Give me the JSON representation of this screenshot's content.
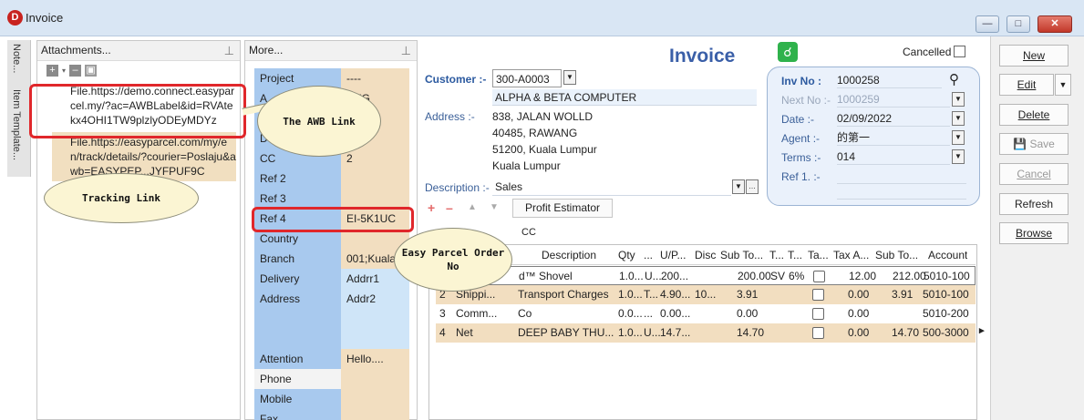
{
  "window": {
    "title": "Invoice",
    "app_icon": "D"
  },
  "side_tabs": [
    "Note...",
    "Item Template..."
  ],
  "attachments": {
    "title": "Attachments...",
    "files": [
      "File.https://demo.connect.easyparcel.my/?ac=AWBLabel&id=RVAtekx4OHI1TW9plzlyODEyMDYz",
      "File.https://easyparcel.com/my/en/track/details/?courier=Poslaju&awb=EASYPEP...JYFPUF9C"
    ]
  },
  "more": {
    "title": "More...",
    "rows": [
      {
        "label": "Project",
        "value": "----"
      },
      {
        "label": "A",
        "value": "ANG"
      },
      {
        "label": "",
        "value": ""
      },
      {
        "label": "D",
        "value": ""
      },
      {
        "label": "CC",
        "value": "2"
      },
      {
        "label": "Ref 2",
        "value": ""
      },
      {
        "label": "Ref 3",
        "value": ""
      },
      {
        "label": "Ref 4",
        "value": "EI-5K1UC"
      },
      {
        "label": "Country",
        "value": ""
      },
      {
        "label": "Branch",
        "value": "001;Kuala"
      },
      {
        "label": "Delivery",
        "value": "Addrr1"
      },
      {
        "label": "Address",
        "value": "Addr2"
      },
      {
        "label": "",
        "value": ""
      },
      {
        "label": "",
        "value": ""
      },
      {
        "label": "Attention",
        "value": "Hello...."
      },
      {
        "label": "Phone",
        "value": ""
      },
      {
        "label": "Mobile",
        "value": ""
      },
      {
        "label": "Fax",
        "value": ""
      }
    ]
  },
  "form": {
    "heading": "Invoice",
    "cancelled_label": "Cancelled",
    "customer_label": "Customer :-",
    "customer_code": "300-A0003",
    "customer_name": "ALPHA & BETA COMPUTER",
    "address_label": "Address :-",
    "address_lines": [
      "838, JALAN WOLLD",
      "40485, RAWANG",
      "51200, Kuala Lumpur",
      "Kuala Lumpur"
    ],
    "description_label": "Description :-",
    "description_value": "Sales",
    "profit_estimator": "Profit Estimator",
    "cc_hint": "CC",
    "inv_no_label": "Inv No :",
    "inv_no": "1000258",
    "next_no_label": "Next No :-",
    "next_no": "1000259",
    "date_label": "Date :-",
    "date": "02/09/2022",
    "agent_label": "Agent :-",
    "agent": "的第一",
    "terms_label": "Terms :-",
    "terms": "014",
    "ref1_label": "Ref 1. :-"
  },
  "grid": {
    "headers": [
      "Description",
      "Qty",
      "...",
      "U/P...",
      "Disc",
      "Sub To...",
      "T...",
      "T...",
      "Ta...",
      "Tax A...",
      "Sub To...",
      "Account"
    ],
    "rows": [
      {
        "seq": "",
        "code": "",
        "desc": "d™ Shovel",
        "qty": "1.0...",
        "uom": "U...",
        "up": "200...",
        "disc": "",
        "sub": "200.00",
        "tc": "SV",
        "tr": "6%",
        "tax": "12.00",
        "total": "212.00",
        "account": "5010-100"
      },
      {
        "seq": "2",
        "code": "Shippi...",
        "desc": "Transport Charges",
        "qty": "1.0...",
        "uom": "T...",
        "up": "4.90...",
        "disc": "10...",
        "sub": "3.91",
        "tc": "",
        "tr": "",
        "tax": "0.00",
        "total": "3.91",
        "account": "5010-100"
      },
      {
        "seq": "3",
        "code": "Comm...",
        "desc": "Co",
        "qty": "0.0...",
        "uom": "...",
        "up": "0.00...",
        "disc": "",
        "sub": "0.00",
        "tc": "",
        "tr": "",
        "tax": "0.00",
        "total": "",
        "account": "5010-200"
      },
      {
        "seq": "4",
        "code": "Net",
        "desc": "DEEP BABY THU...",
        "qty": "1.0...",
        "uom": "U...",
        "up": "14.7...",
        "disc": "",
        "sub": "14.70",
        "tc": "",
        "tr": "",
        "tax": "0.00",
        "total": "14.70",
        "account": "500-3000"
      }
    ]
  },
  "buttons": {
    "new": "New",
    "edit": "Edit",
    "delete": "Delete",
    "save": "Save",
    "cancel": "Cancel",
    "refresh": "Refresh",
    "browse": "Browse"
  },
  "callouts": {
    "awb": "The AWB Link",
    "tracking": "Tracking Link",
    "easyparcel": "Easy Parcel Order No"
  },
  "colors": {
    "label_blue": "#a8c9ee",
    "value_beige": "#f2dec0",
    "highlight_red": "#e0272b",
    "heading_blue": "#3a5fa8",
    "share_green": "#2fb24c"
  }
}
